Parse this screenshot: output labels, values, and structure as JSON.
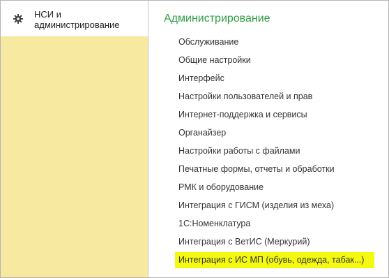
{
  "sidebar": {
    "section": {
      "icon": "gear-icon",
      "label_line1": "НСИ и",
      "label_line2": "администрирование"
    },
    "background_color": "#f8e9a1"
  },
  "main": {
    "title": "Администрирование",
    "title_color": "#2f9e44",
    "items": [
      {
        "label": "Обслуживание"
      },
      {
        "label": "Общие настройки"
      },
      {
        "label": "Интерфейс"
      },
      {
        "label": "Настройки пользователей и прав"
      },
      {
        "label": "Интернет-поддержка и сервисы"
      },
      {
        "label": "Органайзер"
      },
      {
        "label": "Настройки работы с файлами"
      },
      {
        "label": "Печатные формы, отчеты и обработки"
      },
      {
        "label": "РМК и оборудование"
      },
      {
        "label": "Интеграция с ГИСМ (изделия из меха)"
      },
      {
        "label": "1С:Номенклатура"
      },
      {
        "label": "Интеграция с ВетИС (Меркурий)"
      },
      {
        "label": "Интеграция с ИС МП (обувь, одежда, табак...)",
        "highlighted": true
      }
    ],
    "highlight_color": "#f4f90f"
  }
}
